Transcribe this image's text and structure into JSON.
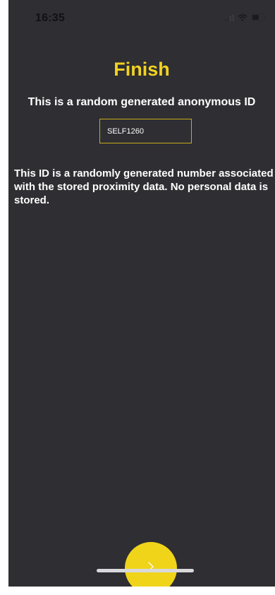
{
  "status_bar": {
    "time": "16:35",
    "icons": [
      "cellular-signal-icon",
      "wifi-icon",
      "battery-icon"
    ]
  },
  "page": {
    "title": "Finish",
    "subtitle": "This is a random generated anonymous ID",
    "anonymous_id": "SELF1260",
    "description": "This ID is a randomly generated number associated with the stored proximity data. No personal data is stored."
  },
  "next_button": {
    "icon": "chevron-right-icon"
  },
  "colors": {
    "background": "#2e2e33",
    "accent": "#f0d41a",
    "text": "#ffffff"
  }
}
